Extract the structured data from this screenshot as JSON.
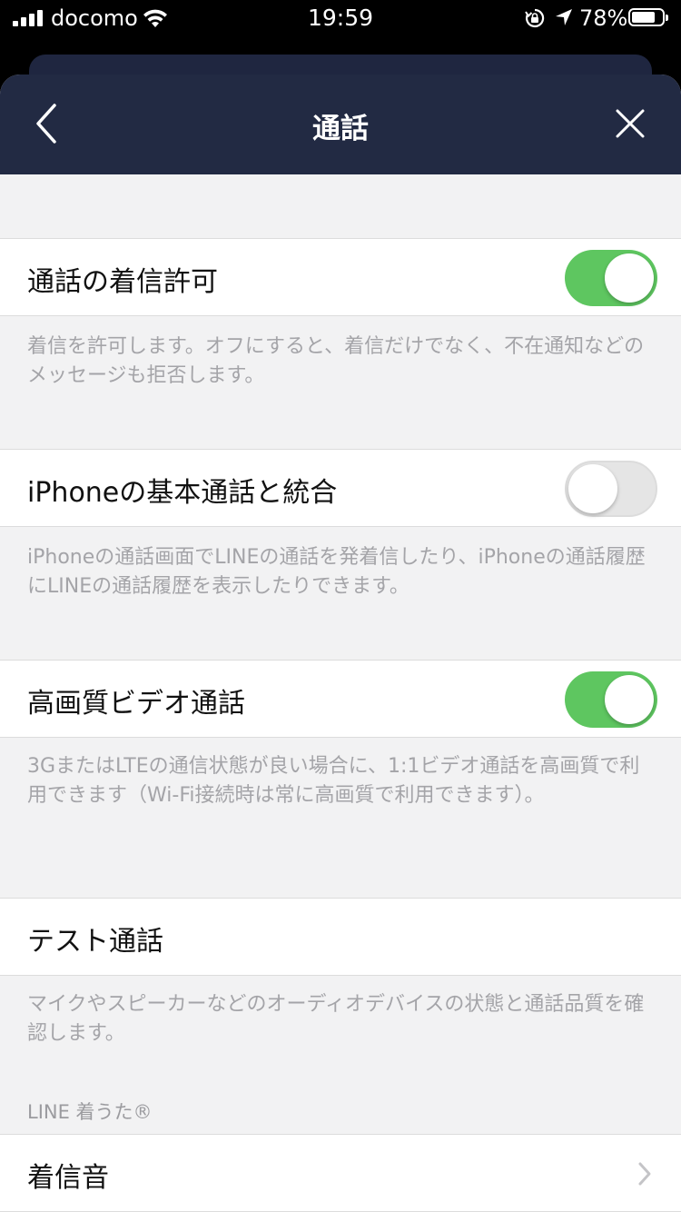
{
  "status_bar": {
    "carrier": "docomo",
    "time": "19:59",
    "battery": "78%",
    "battery_level": 0.78
  },
  "nav": {
    "title": "通話"
  },
  "settings": [
    {
      "label": "通話の着信許可",
      "toggle": "on",
      "desc": "着信を許可します。オフにすると、着信だけでなく、不在通知などのメッセージも拒否します。"
    },
    {
      "label": "iPhoneの基本通話と統合",
      "toggle": "off",
      "desc": "iPhoneの通話画面でLINEの通話を発着信したり、iPhoneの通話履歴にLINEの通話履歴を表示したりできます。"
    },
    {
      "label": "高画質ビデオ通話",
      "toggle": "on",
      "desc": "3GまたはLTEの通信状態が良い場合に、1:1ビデオ通話を高画質で利用できます（Wi-Fi接続時は常に高画質で利用できます）。"
    },
    {
      "label": "テスト通話",
      "desc": "マイクやスピーカーなどのオーディオデバイスの状態と通話品質を確認します。"
    }
  ],
  "ringtone_section": {
    "header": "LINE 着うた®",
    "item_label": "着信音"
  },
  "colors": {
    "nav_bg": "#222a43",
    "toggle_on": "#5ec660",
    "page_bg": "#f2f2f3"
  }
}
